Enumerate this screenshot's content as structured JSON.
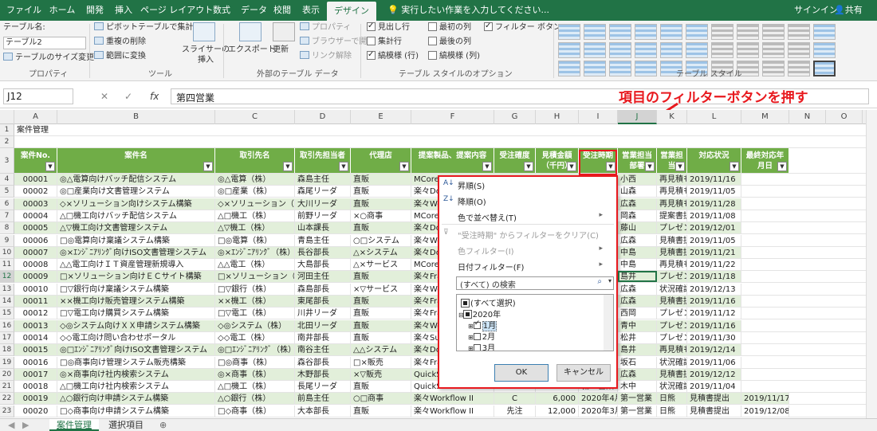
{
  "ribbon_tabs": [
    {
      "label": "ファイル",
      "active": false
    },
    {
      "label": "ホーム",
      "active": false
    },
    {
      "label": "開発",
      "active": false
    },
    {
      "label": "挿入",
      "active": false
    },
    {
      "label": "ページ レイアウト",
      "active": false
    },
    {
      "label": "数式",
      "active": false
    },
    {
      "label": "データ",
      "active": false
    },
    {
      "label": "校閲",
      "active": false
    },
    {
      "label": "表示",
      "active": false
    },
    {
      "label": "デザイン",
      "active": true
    }
  ],
  "tell_me": "実行したい作業を入力してください...",
  "signin": "サインイン",
  "share": "共有",
  "ribbon": {
    "table_name_label": "テーブル名:",
    "table_name_value": "テーブル2",
    "resize_table": "テーブルのサイズ変更",
    "pivot": "ピボットテーブルで集計",
    "remove_dup": "重複の削除",
    "convert_range": "範囲に変換",
    "slicer": "スライサーの挿入",
    "export": "エクスポート",
    "refresh": "更新",
    "properties": "プロパティ",
    "open_browser": "ブラウザーで開く",
    "unlink": "リンク解除",
    "header_row": "見出し行",
    "first_col": "最初の列",
    "filter_button": "フィルター ボタン",
    "total_row": "集計行",
    "last_col": "最後の列",
    "banded_rows": "縞模様 (行)",
    "banded_cols": "縞模様 (列)",
    "grp_properties": "プロパティ",
    "grp_tools": "ツール",
    "grp_external": "外部のテーブル データ",
    "grp_style_opts": "テーブル スタイルのオプション",
    "grp_styles": "テーブル スタイル"
  },
  "name_box": "J12",
  "formula_value": "第四営業",
  "annotation": "項目のフィルターボタンを押す",
  "columns": [
    "A",
    "B",
    "C",
    "D",
    "E",
    "F",
    "G",
    "H",
    "I",
    "J",
    "K",
    "L",
    "M",
    "N",
    "O"
  ],
  "row1_title": "案件管理",
  "headers": [
    "案件No.",
    "案件名",
    "取引先名",
    "取引先担当者",
    "代理店",
    "提案製品、提案内容",
    "受注確度",
    "見積金額（千円）",
    "受注時期",
    "営業担当部署",
    "営業担当",
    "対応状況",
    "最終対応年月日"
  ],
  "rows": [
    [
      "4",
      "00001",
      "◎△電算向けバッチ配信システム",
      "◎△電算（株）",
      "森島主任",
      "直販",
      "MCore",
      "",
      "",
      "第三営業",
      "小西",
      "再見積もり",
      "2019/11/16"
    ],
    [
      "5",
      "00002",
      "◎□産業向け文書管理システム",
      "◎□産業（株）",
      "森尾リーダ",
      "直販",
      "楽々Do",
      "",
      "",
      "第二営業",
      "山森",
      "再見積もり",
      "2019/11/05"
    ],
    [
      "6",
      "00003",
      "◇×ソリューション向けシステム構築",
      "◇×ソリューション（株）",
      "大川リーダ",
      "直販",
      "楽々Wo",
      "",
      "",
      "第三営業",
      "広森",
      "再見積もり",
      "2019/11/28"
    ],
    [
      "7",
      "00004",
      "△□機工向けバッチ配信システム",
      "△□機工（株）",
      "前野リーダ",
      "×○商事",
      "MCore",
      "",
      "",
      "第一営業",
      "岡森",
      "提案書提出",
      "2019/11/08"
    ],
    [
      "8",
      "00005",
      "△▽機工向け文書管理システム",
      "△▽機工（株）",
      "山本課長",
      "直販",
      "楽々Do",
      "",
      "",
      "第二営業",
      "藤山",
      "プレゼン実施",
      "2019/12/01"
    ],
    [
      "9",
      "00006",
      "□◎電算向け稟議システム構築",
      "□◎電算（株）",
      "青島主任",
      "○□システム",
      "楽々Wo",
      "",
      "",
      "第一営業",
      "広森",
      "見積書提出",
      "2019/11/05"
    ],
    [
      "10",
      "00007",
      "◎×ｴﾝｼﾞﾆｱﾘﾝｸﾞ向けISO文書管理システム",
      "◎×ｴﾝｼﾞﾆｱﾘﾝｸﾞ（株）",
      "長谷部長",
      "△×システム",
      "楽々Do",
      "",
      "",
      "第一営業",
      "中島",
      "見積書提出",
      "2019/11/21"
    ],
    [
      "11",
      "00008",
      "△△電工向けＩＴ資産管理新規導入",
      "△△電工（株）",
      "大島部長",
      "△×サービス",
      "MCore",
      "",
      "",
      "第三営業",
      "中島",
      "再見積もり",
      "2019/11/22"
    ],
    [
      "12",
      "00009",
      "□×ソリューション向けＥＣサイト構築",
      "□×ソリューション（株）",
      "河田主任",
      "直販",
      "楽々Fra",
      "",
      "",
      "第四営業",
      "島井",
      "プレゼン実施",
      "2019/11/18"
    ],
    [
      "13",
      "00010",
      "□▽銀行向け稟議システム構築",
      "□▽銀行（株）",
      "森島部長",
      "×▽サービス",
      "楽々Wo",
      "",
      "",
      "第一営業",
      "広森",
      "状況確認中",
      "2019/12/13"
    ],
    [
      "14",
      "00011",
      "××機工向け販売管理システム構築",
      "××機工（株）",
      "東尾部長",
      "直販",
      "楽々Fra",
      "",
      "",
      "第二営業",
      "広森",
      "見積書提出",
      "2019/11/16"
    ],
    [
      "15",
      "00012",
      "□▽電工向け購買システム構築",
      "□▽電工（株）",
      "川井リーダ",
      "直販",
      "楽々Fra",
      "",
      "",
      "第五営業",
      "西岡",
      "プレゼン実施",
      "2019/11/12"
    ],
    [
      "16",
      "00013",
      "◇◎システム向けＸＸ申請システム構築",
      "◇◎システム（株）",
      "北田リーダ",
      "直販",
      "楽々Wo",
      "",
      "",
      "第二営業",
      "青中",
      "プレゼン実施",
      "2019/11/16"
    ],
    [
      "17",
      "00014",
      "◇◇電工向け問い合わせポータル",
      "◇◇電工（株）",
      "南井部長",
      "直販",
      "楽々Su",
      "",
      "",
      "第二営業",
      "松井",
      "プレゼン実施",
      "2019/11/30"
    ],
    [
      "18",
      "00015",
      "◎□ｴﾝｼﾞﾆｱﾘﾝｸﾞ向けISO文書管理システム",
      "◎□ｴﾝｼﾞﾆｱﾘﾝｸﾞ（株）",
      "南谷主任",
      "△△システム",
      "楽々Do",
      "",
      "",
      "第二営業",
      "島井",
      "再見積もり",
      "2019/12/14"
    ],
    [
      "19",
      "00016",
      "□◎商事向け管理システム販売構築",
      "□◎商事（株）",
      "森谷部長",
      "□×販売",
      "楽々Fra",
      "",
      "",
      "第一営業",
      "坂石",
      "状況確認中",
      "2019/11/06"
    ],
    [
      "20",
      "00017",
      "◎×商事向け社内検索システム",
      "◎×商事（株）",
      "木野部長",
      "×▽販売",
      "QuickS",
      "",
      "",
      "第三営業",
      "広森",
      "見積書提出",
      "2019/12/12"
    ],
    [
      "21",
      "00018",
      "△□機工向け社内検索システム",
      "△□機工（株）",
      "長尾リーダ",
      "直販",
      "QuickS",
      "",
      "",
      "第二営業",
      "木中",
      "状況確認中",
      "2019/11/04"
    ],
    [
      "22",
      "00019",
      "△○銀行向け申請システム構築",
      "△○銀行（株）",
      "前島主任",
      "○□商事",
      "楽々Workflow II",
      "C",
      "6,000",
      "2020年4月",
      "第一営業",
      "日熊",
      "見積書提出",
      "2019/11/17"
    ],
    [
      "23",
      "00020",
      "□◇商事向け申請システム構築",
      "□◇商事（株）",
      "大本部長",
      "直販",
      "楽々Workflow II",
      "先注",
      "12,000",
      "2020年3月",
      "第一営業",
      "日熊",
      "見積書提出",
      "2019/12/08"
    ]
  ],
  "filter_menu": {
    "sort_asc": "昇順(S)",
    "sort_desc": "降順(O)",
    "sort_color": "色で並べ替え(T)",
    "clear_filter": "\"受注時期\" からフィルターをクリア(C)",
    "color_filter": "色フィルター(I)",
    "date_filter": "日付フィルター(F)",
    "search_placeholder": "(すべて) の検索",
    "tree": [
      "(すべて選択)",
      "2020年",
      "1月",
      "2月",
      "3月"
    ],
    "ok": "OK",
    "cancel": "キャンセル"
  },
  "sheet_tabs": [
    "案件管理",
    "選択項目"
  ]
}
